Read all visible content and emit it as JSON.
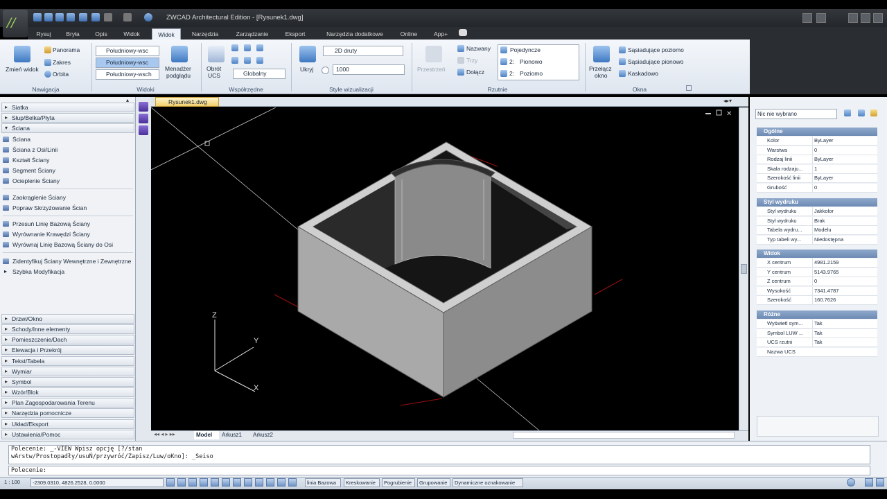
{
  "title": "ZWCAD Architectural Edition - [Rysunek1.dwg]",
  "tabs": [
    "Rysuj",
    "Bryła",
    "Opis",
    "Widok",
    "Widok",
    "Narzędzia",
    "Zarządzanie",
    "Eksport",
    "Narzędzia dodatkowe",
    "Online",
    "App+"
  ],
  "ribbon": {
    "nav": {
      "zoom": "Zmień widok",
      "panorama": "Panorama",
      "zakres": "Zakres",
      "orbita": "Orbita",
      "title": "Nawigacja"
    },
    "views": {
      "v1": "Południowy-wsc",
      "v2": "Południowy-wsc",
      "v3": "Południowy-wsch",
      "manager": "Menadżer",
      "manager2": "podglądu",
      "title": "Widoki"
    },
    "ucs": {
      "obrot": "Obrót",
      "ucs": "UCS",
      "global": "Globalny",
      "title": "Współrzędne"
    },
    "vis": {
      "hide": "Ukryj",
      "mode": "2D druty",
      "value": "1000",
      "title": "Style wizualizacji"
    },
    "viewports": {
      "przestrzen": "Przestrzeń",
      "nazwany": "Nazwany",
      "pojedyncze": "Pojedyncze",
      "trzy": "Trzy",
      "poziomo": "Poziomo",
      "dolacz": "Dołącz",
      "pionowo": "Pionowo",
      "two1": "2:",
      "two2": "2:",
      "title": "Rzutnie"
    },
    "windows": {
      "przelacz": "Przełącz",
      "okno": "okno",
      "sp": "Sąsiadujące poziomo",
      "spion": "Sąsiadujące pionowo",
      "kask": "Kaskadowo",
      "title": "Okna"
    }
  },
  "left_panel": {
    "top_categories": [
      "Siatka",
      "Słup/Belka/Płyta",
      "Ściana"
    ],
    "items_a": [
      "Ściana",
      "Ściana z Osi/Linii",
      "Kształt Ściany",
      "Segment Ściany",
      "Ocieplenie Ściany"
    ],
    "items_b": [
      "Zaokrąglenie Ściany",
      "Popraw Skrzyżowanie Ścian"
    ],
    "items_c": [
      "Przesuń Linię Bazową Ściany",
      "Wyrównanie Krawędzi Ściany",
      "Wyrównaj Linię Bazową Ściany do Osi"
    ],
    "items_d": [
      "Zidentyfikuj Ściany Wewnętrzne i Zewnętrzne",
      "Szybka Modyfikacja"
    ],
    "bottom_categories": [
      "Drzwi/Okno",
      "Schody/Inne elementy",
      "Pomieszczenie/Dach",
      "Elewacja i Przekrój",
      "Tekst/Tabela",
      "Wymiar",
      "Symbol",
      "Wzór/Blok",
      "Plan Zagospodarowania Terenu",
      "Narzędzia pomocnicze",
      "Układ/Eksport",
      "Ustawienia/Pomoc"
    ]
  },
  "document_tab": "Rysunek1.dwg",
  "layout_tabs": [
    "Model",
    "Arkusz1",
    "Arkusz2"
  ],
  "properties": {
    "selector": "Nic nie wybrano",
    "general_title": "Ogólne",
    "general": [
      [
        "Kolor",
        "ByLayer"
      ],
      [
        "Warstwa",
        "0"
      ],
      [
        "Rodzaj linii",
        "ByLayer"
      ],
      [
        "Skala rodzaju...",
        "1"
      ],
      [
        "Szerokość linii",
        "ByLayer"
      ],
      [
        "Grubość",
        "0"
      ]
    ],
    "plot_title": "Styl wydruku",
    "plot": [
      [
        "Styl wydruku",
        "Jakkolor"
      ],
      [
        "Styl wydruku",
        "Brak"
      ],
      [
        "Tabela wydru...",
        "Modelu"
      ],
      [
        "Typ tabeli wy...",
        "Niedostępna"
      ]
    ],
    "view_title": "Widok",
    "view": [
      [
        "X centrum",
        "4981.2159"
      ],
      [
        "Y centrum",
        "5143.9765"
      ],
      [
        "Z centrum",
        "0"
      ],
      [
        "Wysokość",
        "7341.4787"
      ],
      [
        "Szerokość",
        "160.7626"
      ]
    ],
    "misc_title": "Różne",
    "misc": [
      [
        "Wyświetl sym...",
        "Tak"
      ],
      [
        "Symbol LUW ...",
        "Tak"
      ],
      [
        "UCS rzutni",
        "Tak"
      ],
      [
        "Nazwa UCS",
        ""
      ]
    ]
  },
  "command": {
    "history_1": "Polecenie: _-VIEW Wpisz opcję [?/stan",
    "history_2": "wArstw/Prostopadły/usuŃ/przywróć/Zapisz/Luw/oKno]: _Seiso",
    "prompt": "Polecenie:"
  },
  "status": {
    "scale": "1 : 100",
    "coords": "-2309.0310, 4826.2528, 0.0000",
    "toggles": [
      "linia Bazowa",
      "Kreskowanie",
      "Pogrubienie",
      "Grupowanie",
      "Dynamiczne oznakowanie"
    ]
  },
  "axis": {
    "z": "Z",
    "y": "Y",
    "x": "X"
  }
}
